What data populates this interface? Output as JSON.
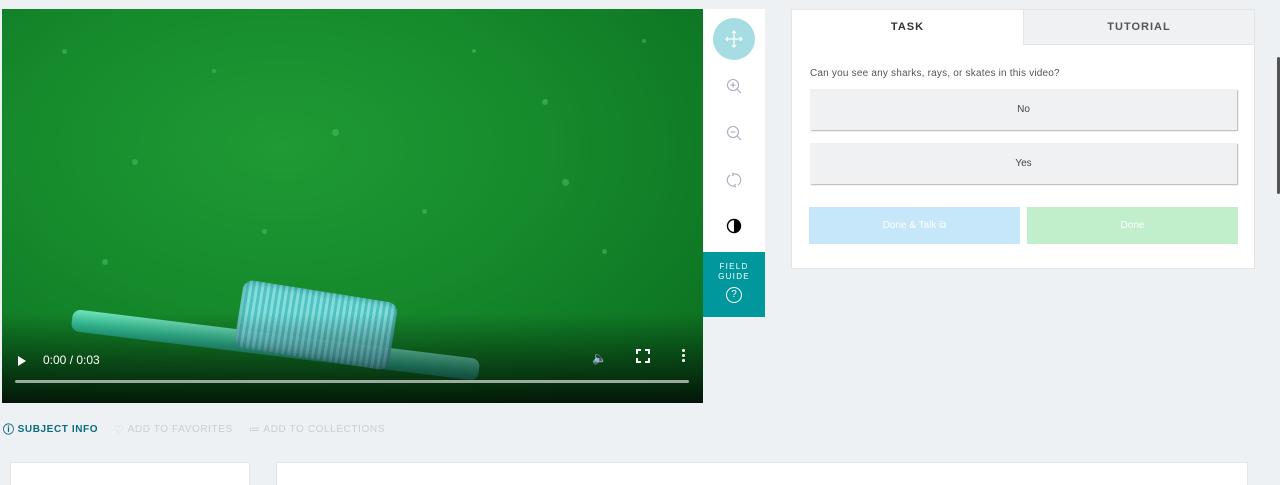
{
  "video": {
    "time": "0:00 / 0:03",
    "progress": 0
  },
  "toolbar": {
    "tools": [
      "move-icon",
      "zoom-in-icon",
      "zoom-out-icon",
      "rotate-icon",
      "invert-icon"
    ],
    "field_guide_label": "FIELD GUIDE",
    "field_guide_icon": "?"
  },
  "task_panel": {
    "tabs": {
      "task": "TASK",
      "tutorial": "TUTORIAL"
    },
    "question": "Can you see any sharks, rays, or skates in this video?",
    "answers": [
      "No",
      "Yes"
    ],
    "done_talk_label": "Done & Talk",
    "done_label": "Done"
  },
  "meta": {
    "subject_info": "SUBJECT INFO",
    "add_favorites": "ADD TO FAVORITES",
    "add_collections": "ADD TO COLLECTIONS"
  },
  "colors": {
    "accent": "#00979d",
    "active_tool": "#a6dde2",
    "done_talk": "#c6e7f9",
    "done": "#c1efcc"
  }
}
